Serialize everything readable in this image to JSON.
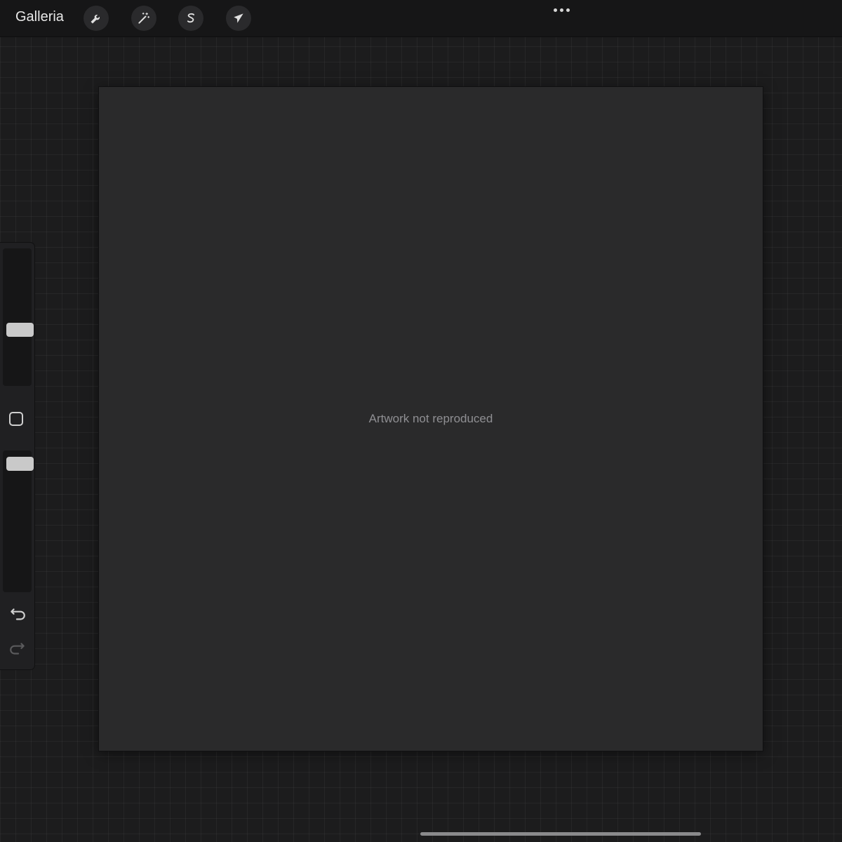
{
  "topbar": {
    "gallery_label": "Galleria",
    "tools": [
      {
        "name": "wrench-icon",
        "role": "actions"
      },
      {
        "name": "magic-wand-icon",
        "role": "adjustments"
      },
      {
        "name": "selection-s-icon",
        "role": "selection"
      },
      {
        "name": "arrow-cursor-icon",
        "role": "transform"
      }
    ],
    "more_icon": "ellipsis-icon"
  },
  "sidebar": {
    "brush_size": 0.4,
    "opacity": 0.95,
    "modify_icon": "square-icon",
    "undo_icon": "undo-icon",
    "redo_icon": "redo-icon"
  },
  "canvas": {
    "placeholder": "Artwork not reproduced"
  },
  "colors": {
    "background": "#1c1c1d",
    "toolbar": "#161617",
    "sidebar": "#202022",
    "slider_thumb": "#c9c9c9"
  }
}
